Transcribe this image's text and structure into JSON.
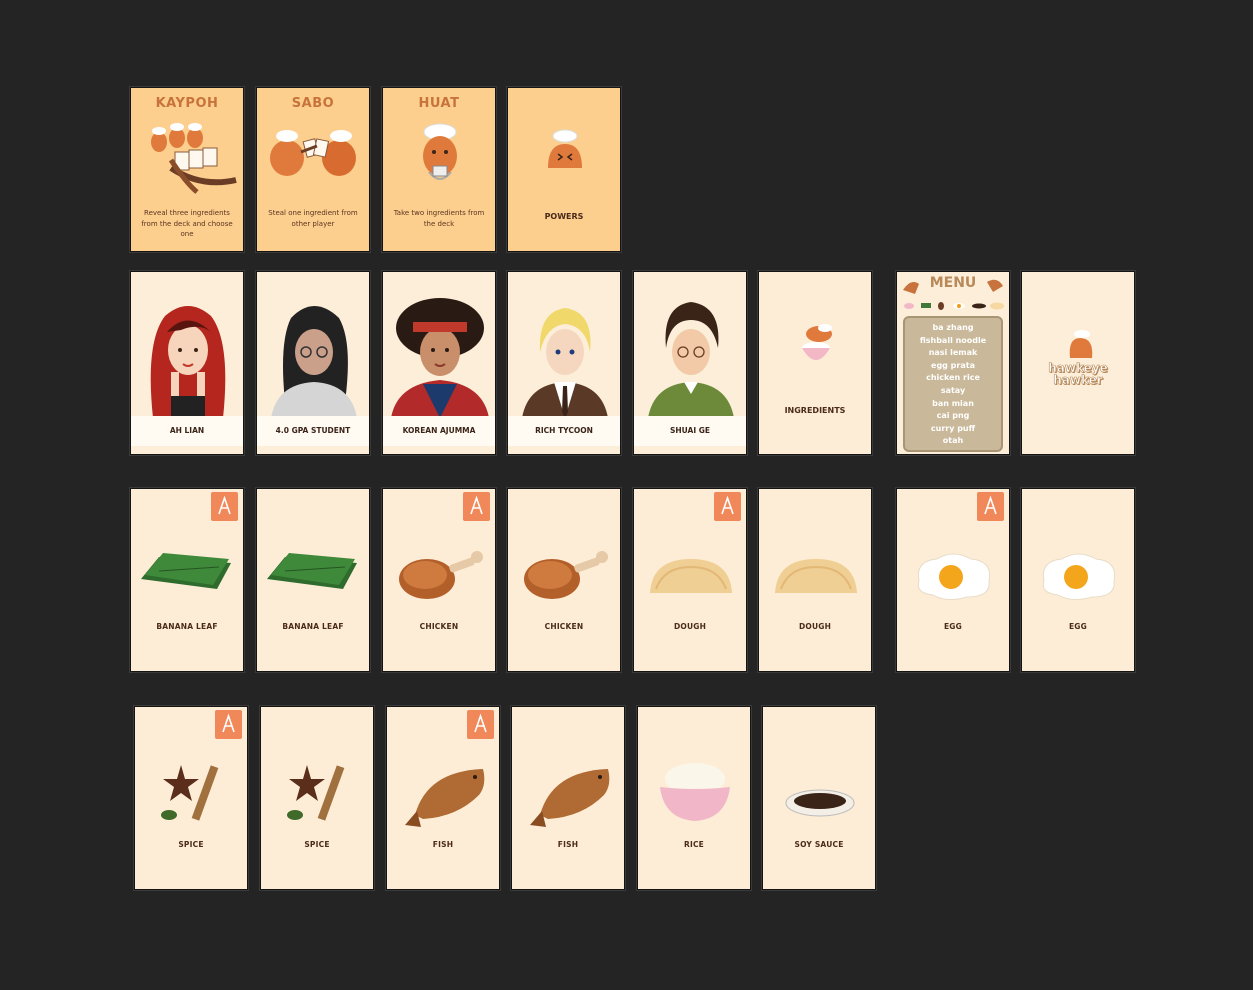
{
  "powers": [
    {
      "title": "KAYPOH",
      "desc": "Reveal three ingredients from the deck and choose one"
    },
    {
      "title": "SABO",
      "desc": "Steal one ingredient from other player"
    },
    {
      "title": "HUAT",
      "desc": "Take two ingredients from the deck"
    }
  ],
  "powers_back_label": "POWERS",
  "characters": [
    {
      "name": "AH LIAN"
    },
    {
      "name": "4.0 GPA STUDENT"
    },
    {
      "name": "KOREAN AJUMMA"
    },
    {
      "name": "RICH TYCOON"
    },
    {
      "name": "SHUAI GE"
    }
  ],
  "ingredients_back_label": "INGREDIENTS",
  "menu": {
    "title": "MENU",
    "items": [
      "ba zhang",
      "fishball noodle",
      "nasi lemak",
      "egg prata",
      "chicken rice",
      "satay",
      "ban mian",
      "cai png",
      "curry puff",
      "otah"
    ]
  },
  "logo": {
    "line1": "hawkeye",
    "line2": "hawker"
  },
  "ingredient_cards": [
    {
      "label": "BANANA LEAF",
      "icon": "banana-leaf-icon"
    },
    {
      "label": "BANANA LEAF",
      "icon": "banana-leaf-icon"
    },
    {
      "label": "CHICKEN",
      "icon": "chicken-drumstick-icon"
    },
    {
      "label": "CHICKEN",
      "icon": "chicken-drumstick-icon"
    },
    {
      "label": "DOUGH",
      "icon": "dough-icon"
    },
    {
      "label": "DOUGH",
      "icon": "dough-icon"
    },
    {
      "label": "EGG",
      "icon": "fried-egg-icon"
    },
    {
      "label": "EGG",
      "icon": "fried-egg-icon"
    },
    {
      "label": "SPICE",
      "icon": "spice-icon"
    },
    {
      "label": "SPICE",
      "icon": "spice-icon"
    },
    {
      "label": "FISH",
      "icon": "fish-icon"
    },
    {
      "label": "FISH",
      "icon": "fish-icon"
    },
    {
      "label": "RICE",
      "icon": "rice-bowl-icon"
    },
    {
      "label": "SOY SAUCE",
      "icon": "soy-sauce-icon"
    }
  ],
  "colors": {
    "canvas": "#242424",
    "power_card": "#fccf8e",
    "ingredient_card": "#fdedd6",
    "badge": "#f0885a"
  }
}
